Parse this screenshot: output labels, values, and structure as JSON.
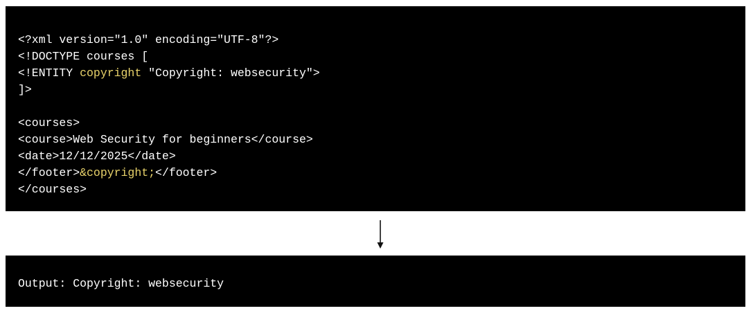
{
  "code": {
    "line1": "<?xml version=\"1.0\" encoding=\"UTF-8\"?>",
    "line2": "<!DOCTYPE courses [",
    "line3_pre": "<!ENTITY ",
    "line3_entity": "copyright",
    "line3_post": " \"Copyright: websecurity\">",
    "line4": "]>",
    "line5": "<courses>",
    "line6": "<course>Web Security for beginners</course>",
    "line7": "<date>12/12/2025</date>",
    "line8_pre": "</footer>",
    "line8_ref": "&copyright;",
    "line8_post": "</footer>",
    "line9": "</courses>"
  },
  "output": {
    "text": "Output: Copyright: websecurity"
  },
  "colors": {
    "panel_bg": "#000000",
    "text": "#ffffff",
    "highlight": "#e8d26a"
  },
  "icons": {
    "arrow": "down-arrow-icon"
  }
}
